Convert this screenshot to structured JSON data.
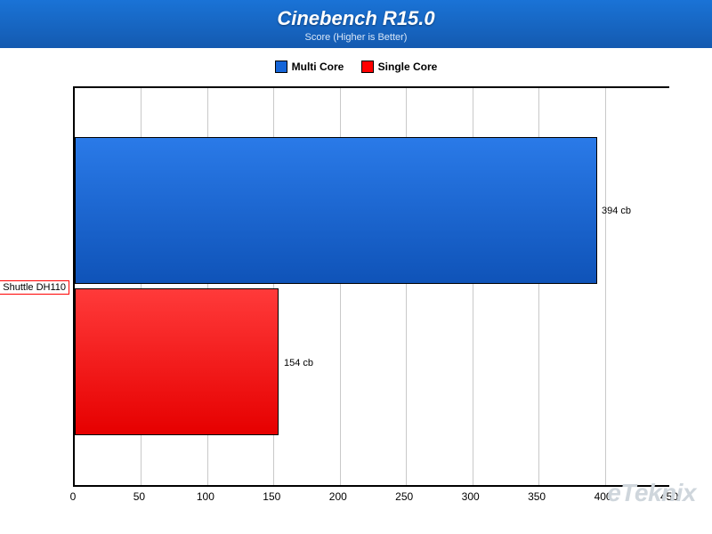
{
  "header": {
    "title": "Cinebench R15.0",
    "subtitle": "Score (Higher is Better)"
  },
  "legend": {
    "items": [
      {
        "label": "Multi Core",
        "color": "#1565d8"
      },
      {
        "label": "Single Core",
        "color": "#ff0000"
      }
    ]
  },
  "ycategory": {
    "label": "Shuttle DH110"
  },
  "bars": {
    "multi": {
      "value_label": "394 cb"
    },
    "single": {
      "value_label": "154 cb"
    }
  },
  "xticks": {
    "t0": "0",
    "t50": "50",
    "t100": "100",
    "t150": "150",
    "t200": "200",
    "t250": "250",
    "t300": "300",
    "t350": "350",
    "t400": "400",
    "t450": "450"
  },
  "watermark": {
    "text": "eTeknix"
  },
  "chart_data": {
    "type": "bar",
    "orientation": "horizontal",
    "title": "Cinebench R15.0",
    "subtitle": "Score (Higher is Better)",
    "categories": [
      "Shuttle DH110"
    ],
    "series": [
      {
        "name": "Multi Core",
        "values": [
          394
        ],
        "unit": "cb",
        "color": "#1565d8"
      },
      {
        "name": "Single Core",
        "values": [
          154
        ],
        "unit": "cb",
        "color": "#ff0000"
      }
    ],
    "xlabel": "",
    "ylabel": "",
    "xlim": [
      0,
      450
    ],
    "xticks": [
      0,
      50,
      100,
      150,
      200,
      250,
      300,
      350,
      400,
      450
    ],
    "grid": {
      "x": true,
      "y": false
    },
    "legend_position": "top"
  }
}
